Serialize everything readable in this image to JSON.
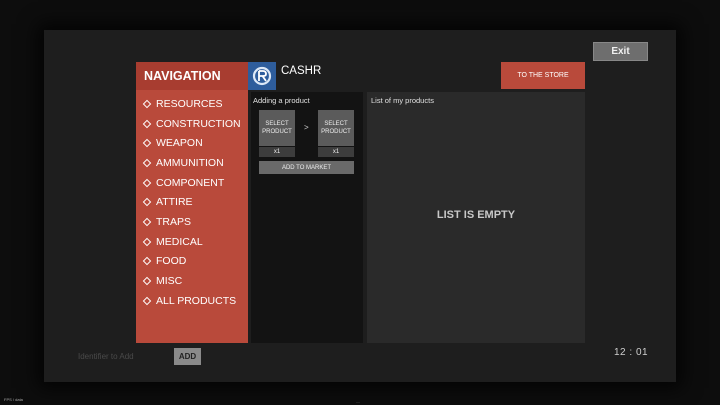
{
  "exit_label": "Exit",
  "nav": {
    "title": "NAVIGATION",
    "items": [
      {
        "label": "RESOURCES"
      },
      {
        "label": "CONSTRUCTION"
      },
      {
        "label": "WEAPON"
      },
      {
        "label": "AMMUNITION"
      },
      {
        "label": "COMPONENT"
      },
      {
        "label": "ATTIRE"
      },
      {
        "label": "TRAPS"
      },
      {
        "label": "MEDICAL"
      },
      {
        "label": "FOOD"
      },
      {
        "label": "MISC"
      },
      {
        "label": "ALL PRODUCTS"
      }
    ]
  },
  "app": {
    "name": "CASHR",
    "logo_icon": "cashr-logo-icon",
    "store_button": "TO THE STORE"
  },
  "add_panel": {
    "title": "Adding a product",
    "slot_left": "SELECT PRODUCT",
    "slot_right": "SELECT PRODUCT",
    "qty_left": "x1",
    "qty_right": "x1",
    "arrow": ">",
    "market_button": "ADD TO MARKET"
  },
  "list_panel": {
    "title": "List of my products",
    "empty_text": "LIST IS EMPTY"
  },
  "footer": {
    "identifier_placeholder": "Identifier to Add",
    "add_button": "ADD",
    "clock": "12 : 01",
    "corner_text": "FPS / data",
    "bottom_mark": "—"
  },
  "colors": {
    "accent": "#b94a3b",
    "accent_dark": "#a83d30",
    "logo_blue": "#2e5d9c"
  }
}
